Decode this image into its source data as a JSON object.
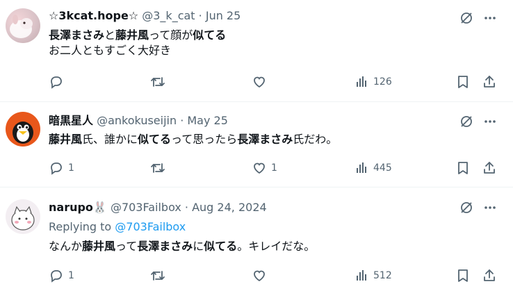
{
  "tweets": [
    {
      "name": "☆3kcat.hope☆",
      "handle": "@3_k_cat",
      "date": "· Jun 25",
      "lines": [
        [
          {
            "t": "長澤まさみ",
            "b": true
          },
          {
            "t": "と",
            "b": false
          },
          {
            "t": "藤井風",
            "b": true
          },
          {
            "t": "って顔が",
            "b": false
          },
          {
            "t": "似てる",
            "b": true
          }
        ],
        [
          {
            "t": "お二人ともすごく大好き",
            "b": false
          }
        ]
      ],
      "reply_count": "",
      "retweet_count": "",
      "like_count": "",
      "view_count": "126"
    },
    {
      "name": "暗黒星人",
      "handle": "@ankokuseijin",
      "date": "· May 25",
      "lines": [
        [
          {
            "t": "藤井風",
            "b": true
          },
          {
            "t": "氏、誰かに",
            "b": false
          },
          {
            "t": "似てる",
            "b": true
          },
          {
            "t": "って思ったら",
            "b": false
          },
          {
            "t": "長澤まさみ",
            "b": true
          },
          {
            "t": "氏だわ。",
            "b": false
          }
        ]
      ],
      "reply_count": "1",
      "retweet_count": "",
      "like_count": "1",
      "view_count": "445"
    },
    {
      "name": "narupo",
      "name_emoji": "🐰",
      "handle": "@703Failbox",
      "date": "· Aug 24, 2024",
      "replying_prefix": "Replying to ",
      "replying_handle": "@703Failbox",
      "lines": [
        [
          {
            "t": "なんか",
            "b": false
          },
          {
            "t": "藤井風",
            "b": true
          },
          {
            "t": "って",
            "b": false
          },
          {
            "t": "長澤まさみ",
            "b": true
          },
          {
            "t": "に",
            "b": false
          },
          {
            "t": "似てる",
            "b": true
          },
          {
            "t": "。キレイだな。",
            "b": false
          }
        ]
      ],
      "reply_count": "1",
      "retweet_count": "",
      "like_count": "",
      "view_count": "512"
    }
  ],
  "icons": {
    "top_right": [
      "grok-icon",
      "more-icon"
    ],
    "actions": [
      "reply-icon",
      "retweet-icon",
      "like-icon",
      "views-icon",
      "bookmark-icon",
      "share-icon"
    ]
  },
  "colors": {
    "text": "#0f1419",
    "secondary": "#536471",
    "link": "#1d9bf0",
    "divider": "#eff3f4"
  }
}
